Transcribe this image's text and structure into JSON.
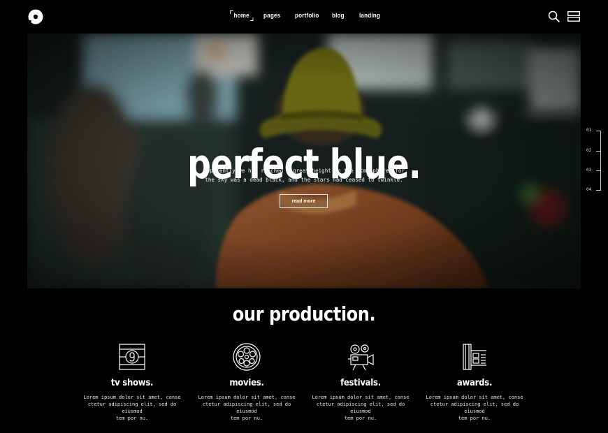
{
  "header": {
    "logo_icon": "disc-logo-icon",
    "nav": [
      {
        "label": "home",
        "active": true
      },
      {
        "label": "pages",
        "active": false
      },
      {
        "label": "portfolio",
        "active": false
      },
      {
        "label": "blog",
        "active": false
      },
      {
        "label": "landing",
        "active": false
      }
    ],
    "search_icon": "search-icon",
    "menu_icon": "menu-icon"
  },
  "hero": {
    "title": "perfect blue.",
    "text_line1": "Apparently we had reached a great height in the atmosphere, for",
    "text_line2": "the sky was a dead black, and the stars had ceased to twinkle.",
    "button_label": "read more",
    "slides": [
      "01",
      "02",
      "03",
      "04"
    ]
  },
  "production": {
    "title": "our production.",
    "features": [
      {
        "icon": "film-countdown-icon",
        "title": "tv shows.",
        "line1": "Lorem ipsum dolor sit amet, conse",
        "line2": "ctetur adipiscing elit, sed do eiusmod",
        "line3": "tem por nu."
      },
      {
        "icon": "film-reel-icon",
        "title": "movies.",
        "line1": "Lorem ipsum dolor sit amet, conse",
        "line2": "ctetur adipiscing elit, sed do eiusmod",
        "line3": "tem por nu."
      },
      {
        "icon": "movie-camera-icon",
        "title": "festivals.",
        "line1": "Lorem ipsum dolor sit amet, conse",
        "line2": "ctetur adipiscing elit, sed do eiusmod",
        "line3": "tem por nu."
      },
      {
        "icon": "film-strip-icon",
        "title": "awards.",
        "line1": "Lorem ipsum dolor sit amet, conse",
        "line2": "ctetur adipiscing elit, sed do eiusmod",
        "line3": "tem por nu."
      }
    ]
  },
  "colors": {
    "background": "#000000",
    "text": "#ffffff"
  }
}
